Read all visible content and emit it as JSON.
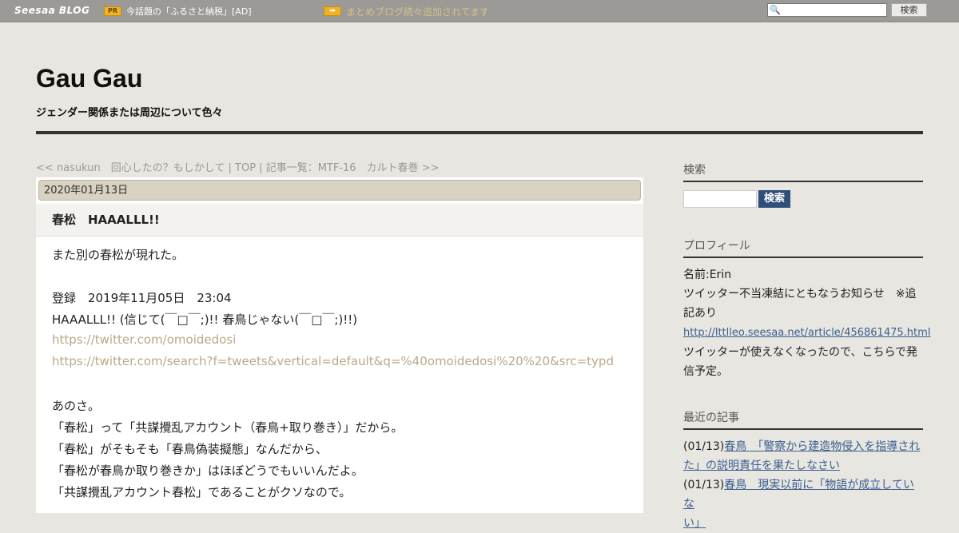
{
  "topbar": {
    "logo": "Seesaa BLOG",
    "pr_badge": "PR",
    "pr_text": "今話題の「ふるさと納税」[AD]",
    "arrow_icon": "arrow-right-icon",
    "info_text": "まとめブログ続々追加されてます",
    "search_button": "検索"
  },
  "header": {
    "title": "Gau Gau",
    "description": "ジェンダー関係または周辺について色々"
  },
  "nav": {
    "prev": "<< nasukun　回心したの？もしかして",
    "top": "TOP",
    "list": "記事一覧：MTF-16　カルト春巻 >>",
    "sep": " | "
  },
  "article": {
    "date": "2020年01月13日",
    "title": "春松　HAAALLL!!",
    "lines": [
      {
        "text": "また別の春松が現れた。",
        "link": false
      },
      {
        "text": "",
        "link": false
      },
      {
        "text": "登録　2019年11月05日　23:04",
        "link": false
      },
      {
        "text": "HAAALLL!! (信じて(￣□￣;)!! 春鳥じゃない(￣□￣;)!!)",
        "link": false
      },
      {
        "text": "https://twitter.com/omoidedosi",
        "link": true
      },
      {
        "text": "https://twitter.com/search?f=tweets&vertical=default&q=%40omoidedosi%20%20&src=typd",
        "link": true
      },
      {
        "text": "",
        "link": false
      },
      {
        "text": "あのさ。",
        "link": false
      },
      {
        "text": "「春松」って「共謀攪乱アカウント（春鳥+取り巻き）」だから。",
        "link": false
      },
      {
        "text": "「春松」がそもそも「春鳥偽装擬態」なんだから、",
        "link": false
      },
      {
        "text": "「春松が春鳥か取り巻きか」はほぼどうでもいいんだよ。",
        "link": false
      },
      {
        "text": "「共謀攪乱アカウント春松」であることがクソなので。",
        "link": false
      }
    ]
  },
  "sidebar": {
    "search": {
      "heading": "検索",
      "button": "検索"
    },
    "profile": {
      "heading": "プロフィール",
      "name": "名前:Erin",
      "notice_1": "ツイッター不当凍結にともなうお知らせ　※追",
      "notice_2": "記あり",
      "link": "http://lttlleo.seesaa.net/article/456861475.html",
      "text_1": "ツイッターが使えなくなったので、こちらで発",
      "text_2": "信予定。"
    },
    "recent": {
      "heading": "最近の記事",
      "items": [
        {
          "date": "(01/13)",
          "title_1": "春鳥　「警察から建造物侵入を指導され",
          "title_2": "た」の説明責任を果たしなさい"
        },
        {
          "date": "(01/13)",
          "title_1": "春鳥　現実以前に「物語が成立していな",
          "title_2": "い」"
        }
      ]
    }
  }
}
